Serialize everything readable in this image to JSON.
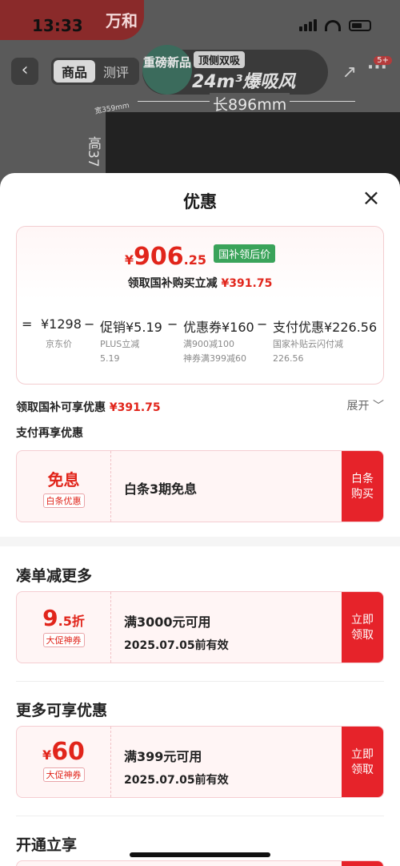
{
  "status": {
    "time": "13:33"
  },
  "background": {
    "brand": "万和",
    "tabs": [
      "商品",
      "测评"
    ],
    "banner_round": "重磅新品",
    "banner_tag": "顶侧双吸",
    "banner_big": "24m³爆吸风",
    "more_badge": "5+",
    "width_label": "长896mm",
    "depth_label": "宽359mm",
    "height_label": "高37"
  },
  "sheet": {
    "title": "优惠",
    "price": {
      "currency": "¥",
      "integer": "906",
      "decimal": ".25",
      "badge": "国补领后价",
      "subtitle": "领取国补购买立减",
      "subtitle_amount": "¥391.75"
    },
    "formula": {
      "eq": "=",
      "base": "¥1298",
      "base_label": "京东价",
      "minus1": "−",
      "promo": "促销¥5.19",
      "promo_note": "PLUS立减",
      "promo_note2": "5.19",
      "minus2": "−",
      "coupon": "优惠券¥160",
      "coupon_note": "满900减100",
      "coupon_note2": "神券满399减60",
      "minus3": "−",
      "pay": "支付优惠¥226.56",
      "pay_note": "国家补贴云闪付减",
      "pay_note2": "226.56"
    },
    "subsidy_line": "领取国补可享优惠",
    "subsidy_amount": "¥391.75",
    "expand": "展开 ﹀",
    "pay_title": "支付再享优惠",
    "baitiao": {
      "big": "免息",
      "tag": "白条优惠",
      "title": "白条3期免息",
      "action": [
        "白条",
        "购买"
      ]
    },
    "section_more_order": "凑单减更多",
    "coupon1": {
      "big": "9",
      "big_small": ".5折",
      "tag": "大促神券",
      "title": "满3000元可用",
      "date": "2025.07.05前有效",
      "action": [
        "立即",
        "领取"
      ]
    },
    "section_more_offers": "更多可享优惠",
    "coupon2": {
      "currency": "¥",
      "big": "60",
      "tag": "大促神券",
      "title": "满399元可用",
      "date": "2025.07.05前有效",
      "action": [
        "立即",
        "领取"
      ]
    },
    "section_open": "开通立享"
  },
  "colors": {
    "accent": "#e1251b",
    "badge_green": "#3aa35a",
    "action_red": "#e6232a"
  }
}
